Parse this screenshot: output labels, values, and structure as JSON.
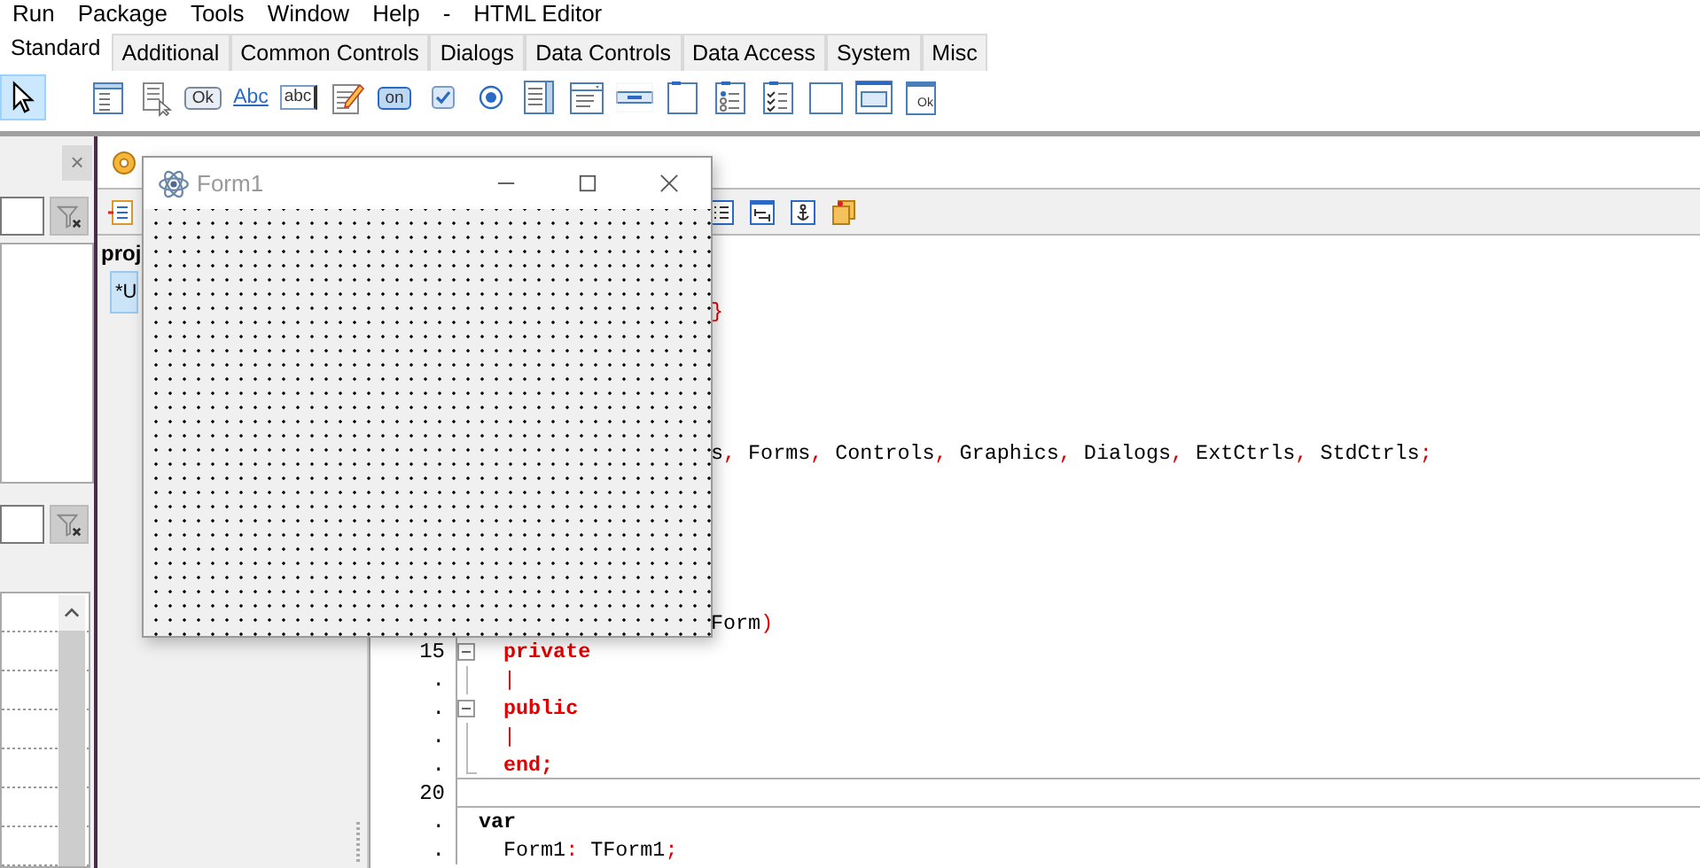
{
  "menu_bar": {
    "items": [
      "Run",
      "Package",
      "Tools",
      "Window",
      "Help",
      "-",
      "HTML Editor"
    ]
  },
  "component_palette": {
    "tabs": [
      {
        "label": "Standard",
        "selected": true
      },
      {
        "label": "Additional",
        "selected": false
      },
      {
        "label": "Common Controls",
        "selected": false
      },
      {
        "label": "Dialogs",
        "selected": false
      },
      {
        "label": "Data Controls",
        "selected": false
      },
      {
        "label": "Data Access",
        "selected": false
      },
      {
        "label": "System",
        "selected": false
      },
      {
        "label": "Misc",
        "selected": false
      }
    ],
    "tools": [
      {
        "kind": "pointer",
        "selected": true
      },
      {
        "kind": "main-menu",
        "selected": false
      },
      {
        "kind": "popup-menu",
        "selected": false
      },
      {
        "kind": "button",
        "label": "Ok",
        "selected": false
      },
      {
        "kind": "label",
        "label": "Abc",
        "selected": false
      },
      {
        "kind": "edit",
        "label": "abc",
        "selected": false
      },
      {
        "kind": "memo",
        "selected": false
      },
      {
        "kind": "toggle",
        "label": "on",
        "selected": false
      },
      {
        "kind": "checkbox",
        "selected": false
      },
      {
        "kind": "radio",
        "selected": false
      },
      {
        "kind": "listbox",
        "selected": false
      },
      {
        "kind": "combobox",
        "selected": false
      },
      {
        "kind": "scrollbar",
        "selected": false
      },
      {
        "kind": "groupbox",
        "selected": false
      },
      {
        "kind": "radiogroup",
        "selected": false
      },
      {
        "kind": "checkgroup",
        "selected": false
      },
      {
        "kind": "panel",
        "selected": false
      },
      {
        "kind": "frame",
        "selected": false
      },
      {
        "kind": "actionlist",
        "label": "Ok",
        "selected": false
      }
    ]
  },
  "object_inspector": {
    "close_button": {
      "label": "×",
      "disabled": true
    }
  },
  "project_inspector": {
    "title": "proj",
    "items": [
      {
        "label": "*U",
        "selected": true
      }
    ]
  },
  "source_editor": {
    "partly_covered_lines": [
      [
        {
          "kind": "symbol",
          "text": "}"
        }
      ],
      [
        {
          "kind": "text",
          "text": "s"
        },
        {
          "kind": "symbol",
          "text": ","
        },
        {
          "kind": "text",
          "text": " Forms"
        },
        {
          "kind": "symbol",
          "text": ","
        },
        {
          "kind": "text",
          "text": " Controls"
        },
        {
          "kind": "symbol",
          "text": ","
        },
        {
          "kind": "text",
          "text": " Graphics"
        },
        {
          "kind": "symbol",
          "text": ","
        },
        {
          "kind": "text",
          "text": " Dialogs"
        },
        {
          "kind": "symbol",
          "text": ","
        },
        {
          "kind": "text",
          "text": " ExtCtrls"
        },
        {
          "kind": "symbol",
          "text": ","
        },
        {
          "kind": "text",
          "text": " StdCtrls"
        },
        {
          "kind": "symbol",
          "text": ";"
        }
      ],
      [
        {
          "kind": "text",
          "text": "Form"
        },
        {
          "kind": "symbol",
          "text": ")"
        }
      ]
    ],
    "rows": [
      {
        "number": "15",
        "fold_marker": true,
        "indented": true,
        "divider_below": false,
        "segments": [
          {
            "kind": "keyword",
            "text": "private"
          }
        ]
      },
      {
        "number": ".",
        "fold_marker": false,
        "block_end": false,
        "indented": true,
        "divider_below": false,
        "segments": [
          {
            "kind": "symbol",
            "text": "|"
          }
        ]
      },
      {
        "number": ".",
        "fold_marker": true,
        "indented": true,
        "divider_below": false,
        "segments": [
          {
            "kind": "keyword",
            "text": "public"
          }
        ]
      },
      {
        "number": ".",
        "fold_marker": false,
        "block_end": false,
        "indented": true,
        "divider_below": false,
        "segments": [
          {
            "kind": "symbol",
            "text": "|"
          }
        ]
      },
      {
        "number": ".",
        "fold_marker": false,
        "block_end": true,
        "indented": true,
        "divider_below": true,
        "segments": [
          {
            "kind": "keyword",
            "text": "end;"
          }
        ]
      },
      {
        "number": "20",
        "divider_below": true
      },
      {
        "number": ".",
        "indented": false,
        "divider_below": false,
        "segments": [
          {
            "kind": "reserved",
            "text": "var"
          }
        ]
      },
      {
        "number": ".",
        "indented": true,
        "divider_below": false,
        "segments": [
          {
            "kind": "text",
            "text": "Form1"
          },
          {
            "kind": "symbol",
            "text": ":"
          },
          {
            "kind": "text",
            "text": " TForm1"
          },
          {
            "kind": "symbol",
            "text": ";"
          }
        ]
      }
    ]
  },
  "form_designer": {
    "title": "Form1",
    "active": false
  }
}
